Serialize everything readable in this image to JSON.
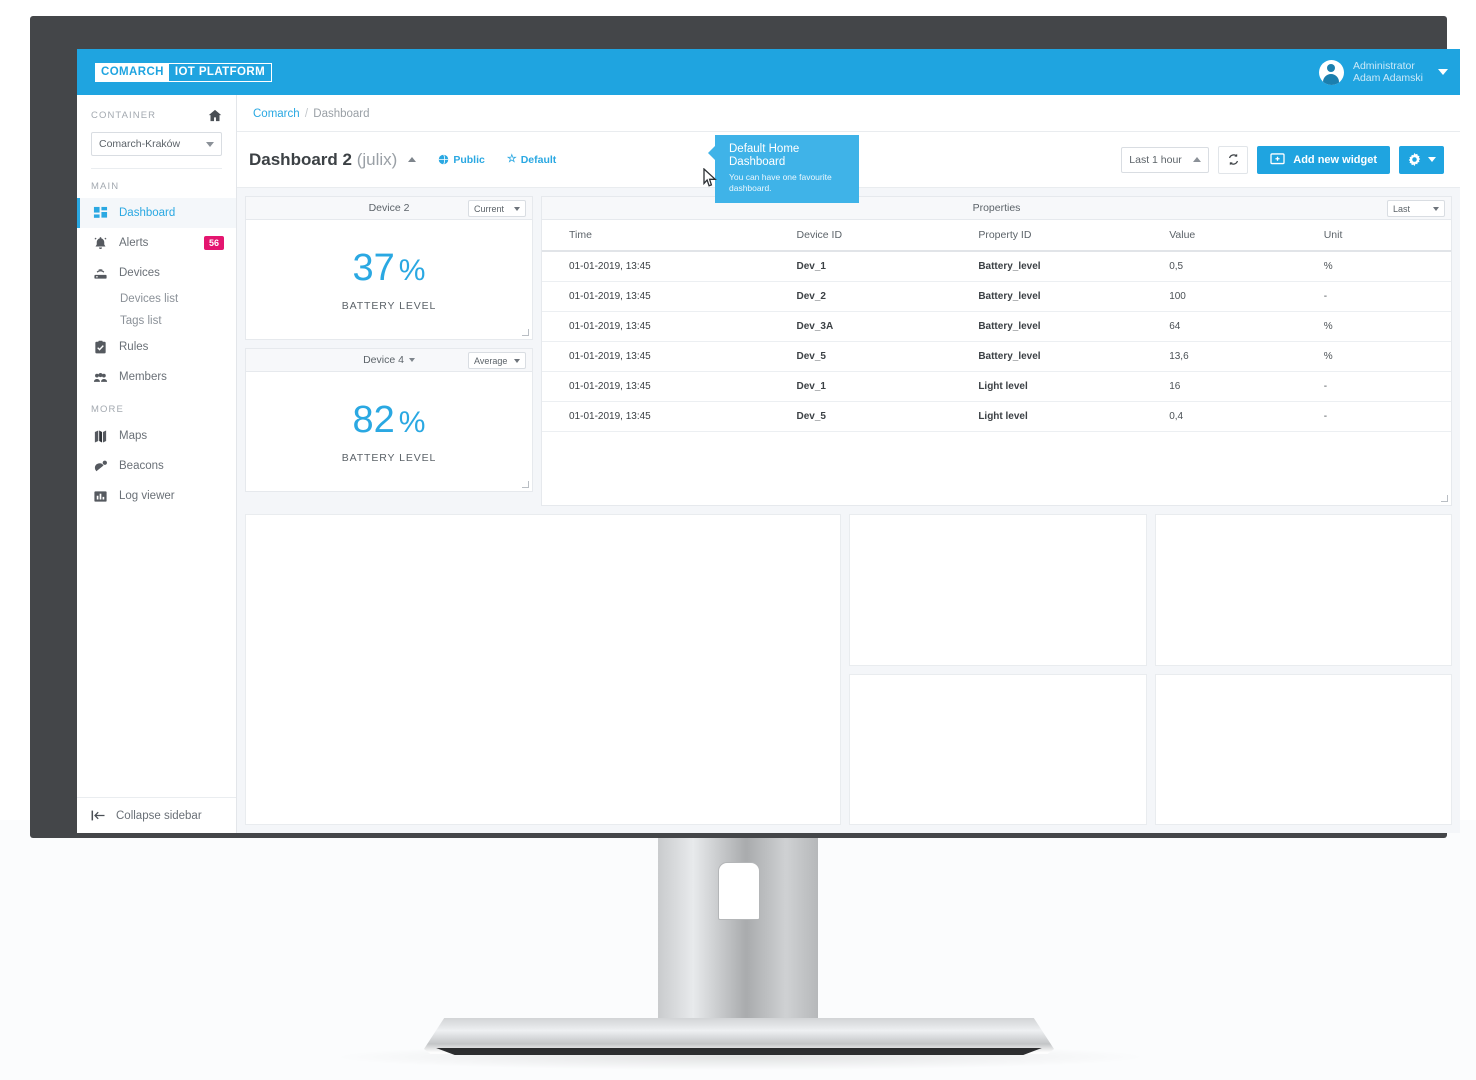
{
  "brand": {
    "logo_mark": "COMARCH",
    "logo_word": "IOT PLATFORM",
    "accent_color": "#1fa4e0",
    "badge_color": "#e4156f"
  },
  "topbar": {
    "user_role": "Administrator",
    "user_name": "Adam Adamski",
    "avatar_icon": "user-avatar-icon",
    "caret_icon": "chevron-down-icon"
  },
  "sidebar": {
    "container_label": "CONTAINER",
    "home_icon": "home-icon",
    "container_value": "Comarch-Kraków",
    "group_main": "MAIN",
    "group_more": "MORE",
    "items_main": [
      {
        "label": "Dashboard",
        "icon": "dashboard-grid-icon",
        "active": true,
        "badge": ""
      },
      {
        "label": "Alerts",
        "icon": "alert-bell-icon",
        "active": false,
        "badge": "56"
      },
      {
        "label": "Devices",
        "icon": "device-router-icon",
        "active": false,
        "badge": ""
      }
    ],
    "sub_items": [
      {
        "label": "Devices list"
      },
      {
        "label": "Tags list"
      }
    ],
    "items_main2": [
      {
        "label": "Rules",
        "icon": "rules-clipboard-icon",
        "active": false,
        "badge": ""
      },
      {
        "label": "Members",
        "icon": "members-people-icon",
        "active": false,
        "badge": ""
      }
    ],
    "items_more": [
      {
        "label": "Maps",
        "icon": "map-icon",
        "active": false,
        "badge": ""
      },
      {
        "label": "Beacons",
        "icon": "beacon-icon",
        "active": false,
        "badge": ""
      },
      {
        "label": "Log viewer",
        "icon": "log-viewer-chart-icon",
        "active": false,
        "badge": ""
      }
    ],
    "collapse_label": "Collapse sidebar",
    "collapse_icon": "collapse-left-arrow-icon"
  },
  "breadcrumb": {
    "root": "Comarch",
    "separator": "/",
    "current": "Dashboard"
  },
  "toolbar": {
    "title": "Dashboard 2",
    "title_owner": "(julix)",
    "title_caret_icon": "chevron-up-icon",
    "public_label": "Public",
    "public_icon": "globe-icon",
    "default_label": "Default",
    "default_icon": "star-icon",
    "time_range": "Last 1 hour",
    "time_caret_icon": "chevron-up-icon",
    "refresh_icon": "refresh-icon",
    "add_widget_label": "Add new widget",
    "add_widget_icon": "add-widget-monitor-icon",
    "settings_icon": "gear-icon",
    "settings_caret_icon": "chevron-down-icon"
  },
  "tooltip": {
    "title": "Default Home Dashboard",
    "body": "You can have one favourite dashboard.",
    "cursor_icon": "mouse-pointer-icon"
  },
  "widgets": {
    "kpi": [
      {
        "device": "Device 2",
        "device_has_caret": false,
        "aggregation": "Current",
        "value": "37",
        "unit": "%",
        "label": "BATTERY LEVEL"
      },
      {
        "device": "Device 4",
        "device_has_caret": true,
        "aggregation": "Average",
        "value": "82",
        "unit": "%",
        "label": "BATTERY LEVEL"
      }
    ],
    "properties": {
      "title": "Properties",
      "range_select": "Last",
      "columns": [
        "Time",
        "Device ID",
        "Property ID",
        "Value",
        "Unit"
      ],
      "rows": [
        [
          "01-01-2019, 13:45",
          "Dev_1",
          "Battery_level",
          "0,5",
          "%"
        ],
        [
          "01-01-2019, 13:45",
          "Dev_2",
          "Battery_level",
          "100",
          "-"
        ],
        [
          "01-01-2019, 13:45",
          "Dev_3A",
          "Battery_level",
          "64",
          "%"
        ],
        [
          "01-01-2019, 13:45",
          "Dev_5",
          "Battery_level",
          "13,6",
          "%"
        ],
        [
          "01-01-2019, 13:45",
          "Dev_1",
          "Light level",
          "16",
          "-"
        ],
        [
          "01-01-2019, 13:45",
          "Dev_5",
          "Light level",
          "0,4",
          "-"
        ]
      ]
    },
    "placeholders": 5
  }
}
